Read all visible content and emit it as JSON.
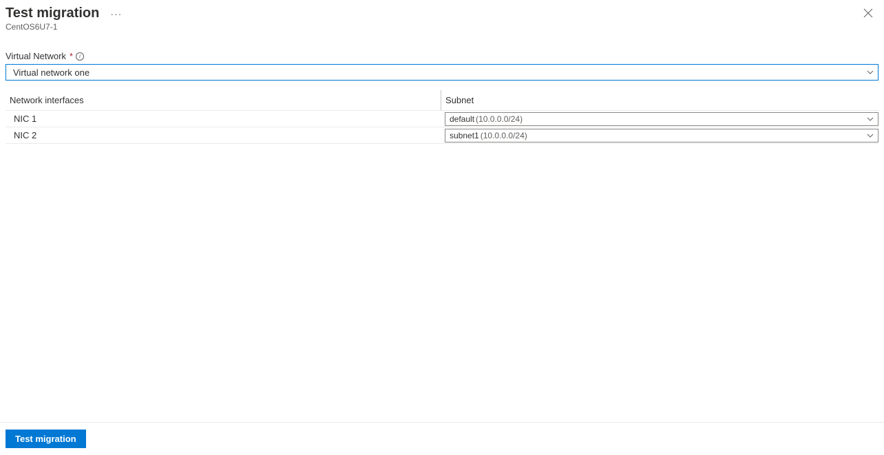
{
  "header": {
    "title": "Test migration",
    "subtitle": "CentOS6U7-1"
  },
  "vnet": {
    "label": "Virtual Network",
    "selected": "Virtual network one"
  },
  "table": {
    "header_nic": "Network interfaces",
    "header_subnet": "Subnet",
    "rows": [
      {
        "nic": "NIC 1",
        "subnet_name": "default",
        "subnet_cidr": "(10.0.0.0/24)"
      },
      {
        "nic": "NIC 2",
        "subnet_name": "subnet1",
        "subnet_cidr": "(10.0.0.0/24)"
      }
    ]
  },
  "footer": {
    "button": "Test migration"
  }
}
